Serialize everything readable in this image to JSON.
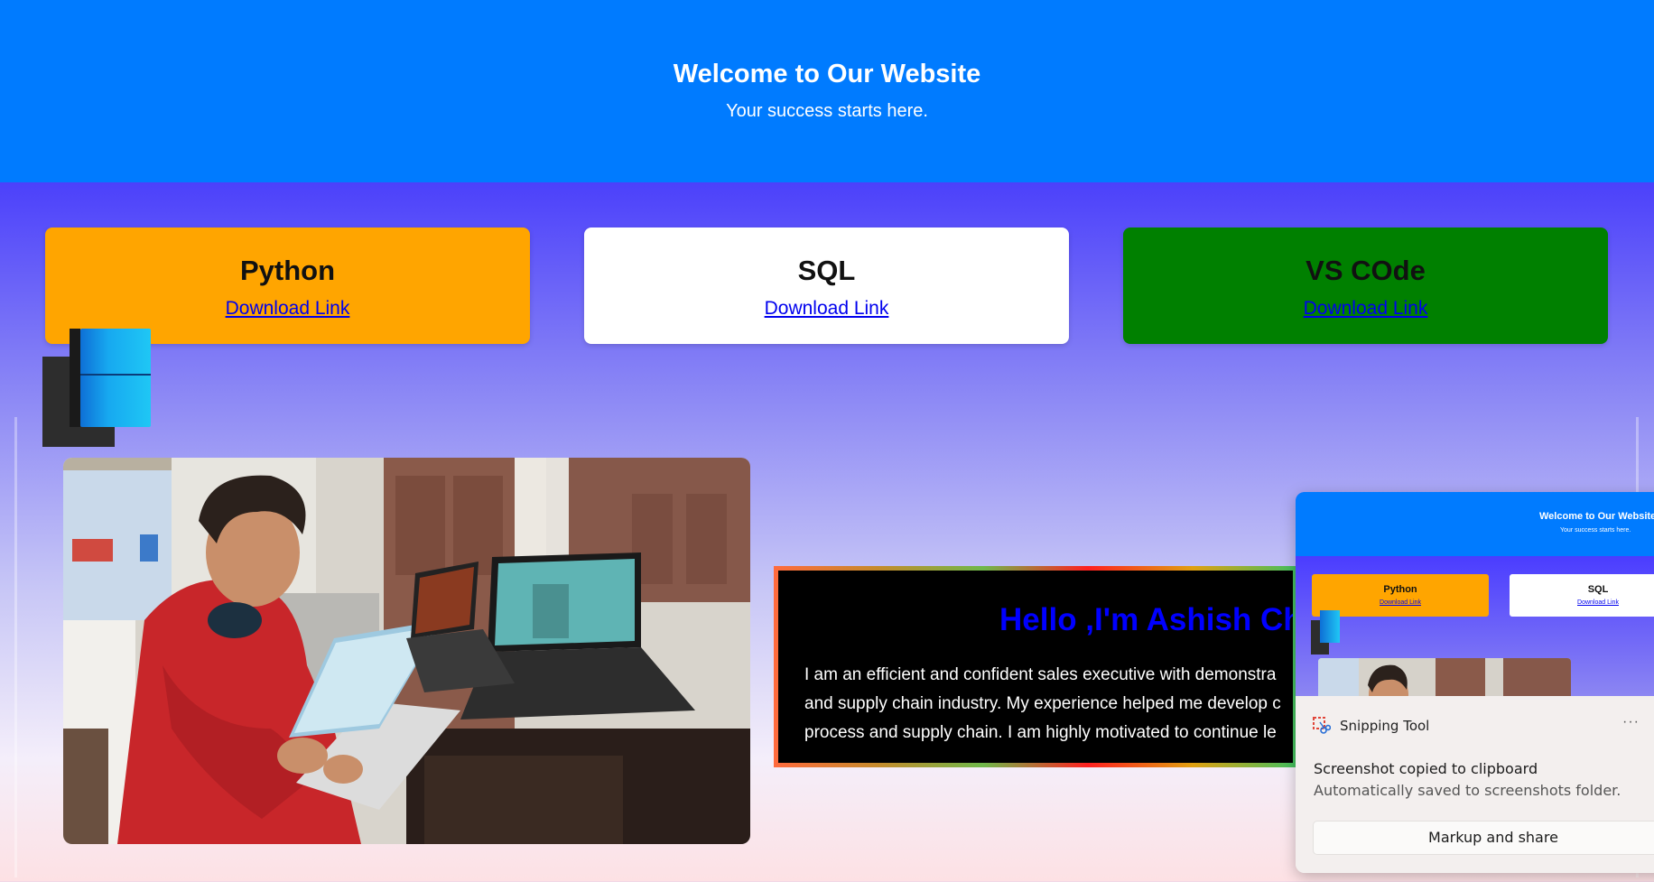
{
  "header": {
    "title": "Welcome to Our Website",
    "subtitle": "Your success starts here."
  },
  "cards": [
    {
      "title": "Python",
      "link": "Download Link",
      "color": "#ffa500"
    },
    {
      "title": "SQL",
      "link": "Download Link",
      "color": "#ffffff"
    },
    {
      "title": "VS COde",
      "link": "Download Link",
      "color": "#008000"
    }
  ],
  "intro": {
    "heading": "Hello ,I'm Ashish Ch",
    "line1": "I am an efficient and confident sales executive with demonstra",
    "line2": "and supply chain industry. My experience helped me develop c",
    "line3": "process and supply chain. I am highly motivated to continue le"
  },
  "snip": {
    "app_name": "Snipping Tool",
    "more": "···",
    "title": "Screenshot copied to clipboard",
    "subtitle": "Automatically saved to screenshots folder.",
    "button": "Markup and share",
    "preview": {
      "title": "Welcome to Our Website",
      "subtitle": "Your success starts here.",
      "card1": "Python",
      "card2": "SQL",
      "link": "Download Link"
    }
  },
  "colors": {
    "header_bg": "#007bff",
    "intro_heading": "#0000ff"
  }
}
